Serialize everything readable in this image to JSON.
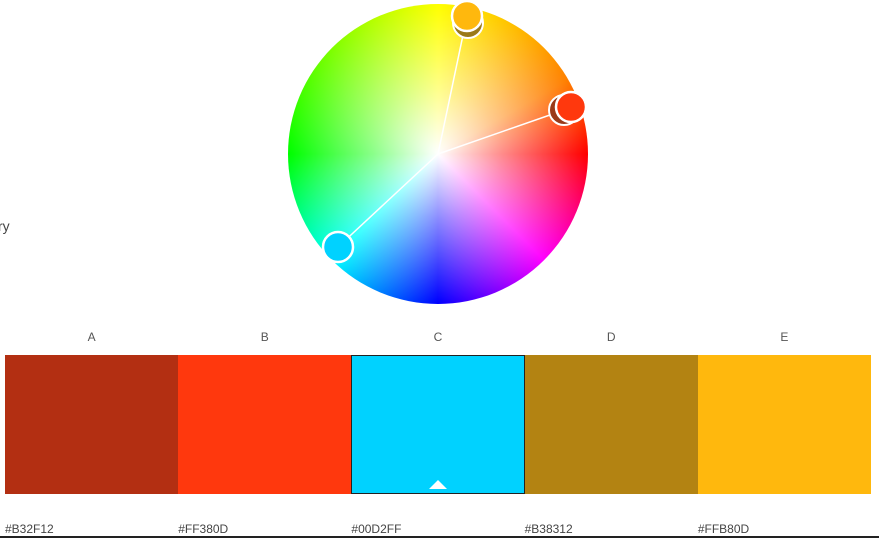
{
  "side_label": "ry",
  "wheel": {
    "handles": [
      {
        "name": "handle-yellow",
        "color": "#FFB80D"
      },
      {
        "name": "handle-orange-red",
        "color": "#FF380D"
      },
      {
        "name": "handle-cyan",
        "color": "#00D2FF"
      }
    ]
  },
  "swatches": [
    {
      "label": "A",
      "hex": "#B32F12",
      "selected": false
    },
    {
      "label": "B",
      "hex": "#FF380D",
      "selected": false
    },
    {
      "label": "C",
      "hex": "#00D2FF",
      "selected": true
    },
    {
      "label": "D",
      "hex": "#B38312",
      "selected": false
    },
    {
      "label": "E",
      "hex": "#FFB80D",
      "selected": false
    }
  ]
}
